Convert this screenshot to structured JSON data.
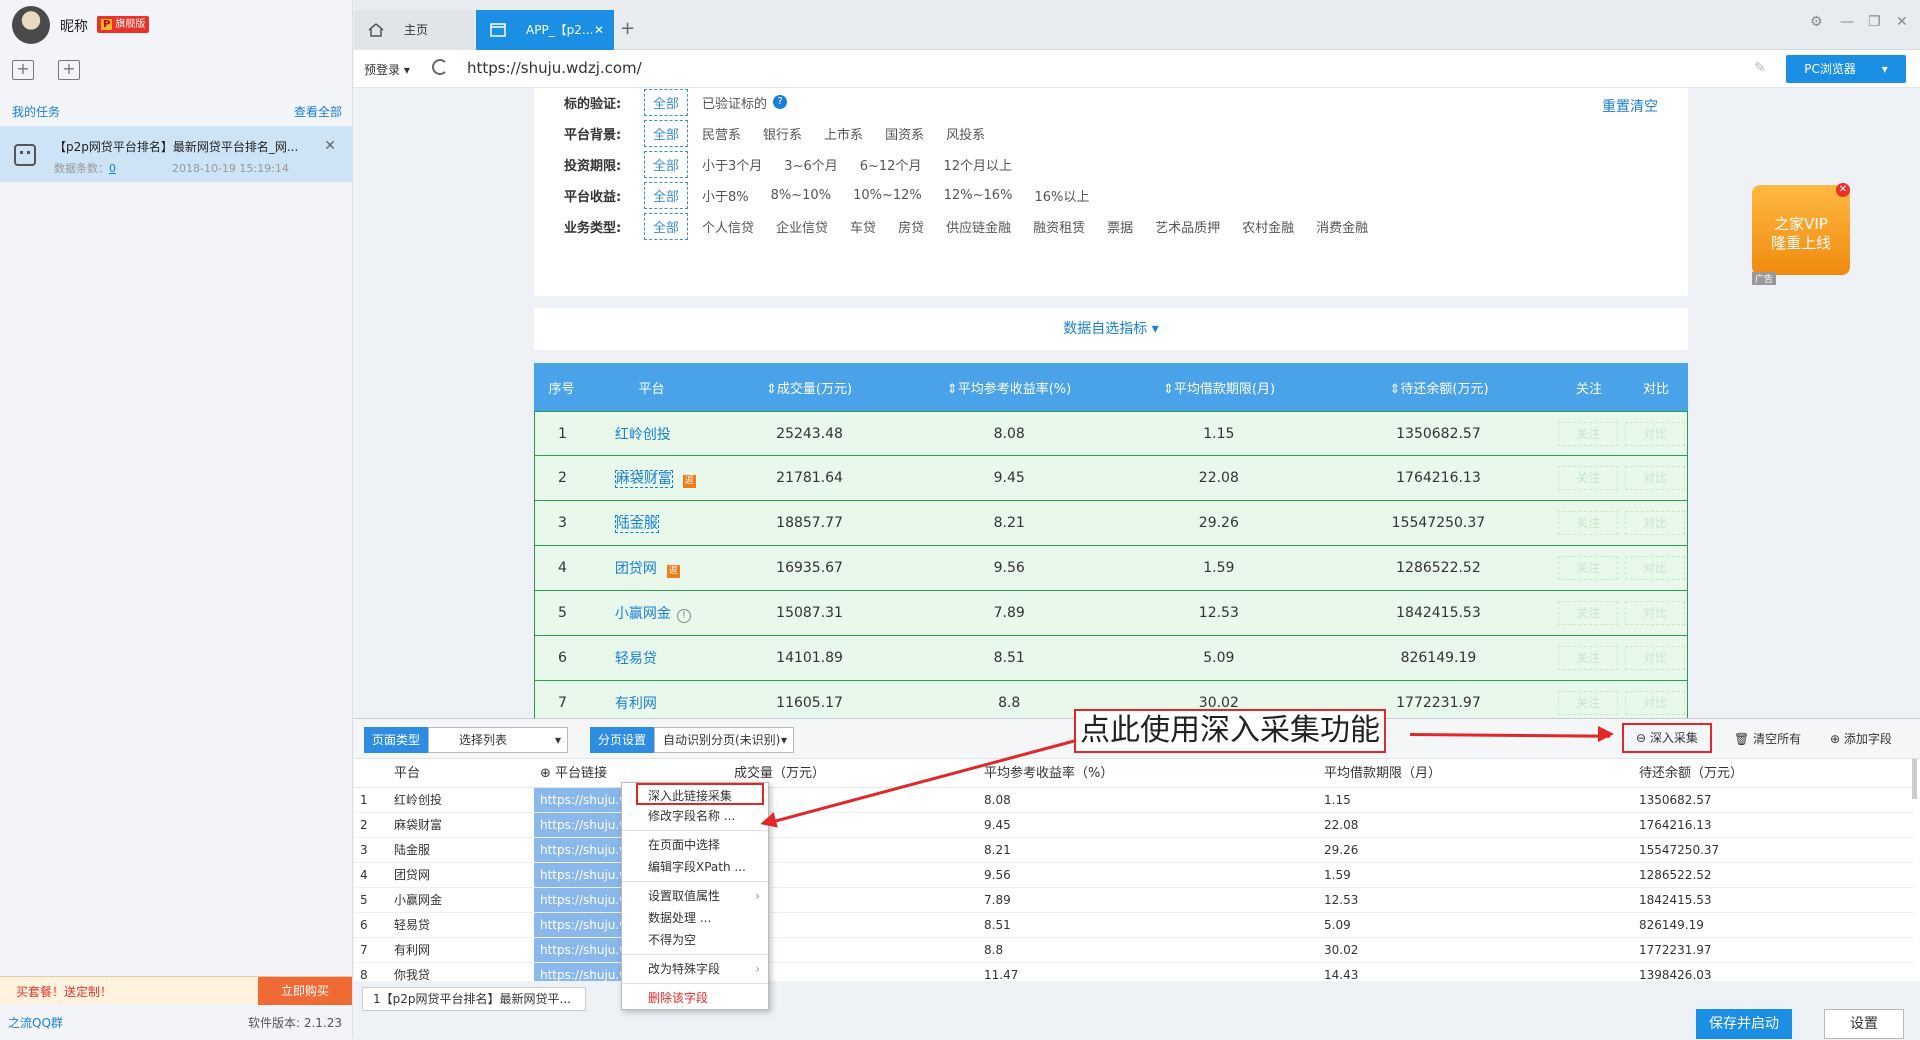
{
  "user": {
    "nickname": "昵称",
    "badge_p": "P",
    "badge_text": "旗舰版"
  },
  "sidebar": {
    "my_tasks": "我的任务",
    "view_all": "查看全部",
    "task": {
      "title": "【p2p网贷平台排名】最新网贷平台排名_网...",
      "count_label": "数据条数：",
      "count": "0",
      "time": "2018-10-19 15:19:14"
    },
    "promo": {
      "text": "买套餐！送定制！",
      "buy": "立即购买"
    },
    "qq": "之流QQ群",
    "version": "软件版本: 2.1.23"
  },
  "tabs": [
    {
      "label": "主页"
    },
    {
      "label": "APP_【p2..."
    }
  ],
  "address": {
    "prelogin": "预登录",
    "url": "https://shuju.wdzj.com/",
    "mode_button": "PC浏览器"
  },
  "filters": {
    "reset": "重置清空",
    "all": "全部",
    "rows": [
      {
        "label": "标的验证:",
        "options": [
          "已验证标的"
        ]
      },
      {
        "label": "平台背景:",
        "options": [
          "民营系",
          "银行系",
          "上市系",
          "国资系",
          "风投系"
        ]
      },
      {
        "label": "投资期限:",
        "options": [
          "小于3个月",
          "3~6个月",
          "6~12个月",
          "12个月以上"
        ]
      },
      {
        "label": "平台收益:",
        "options": [
          "小于8%",
          "8%~10%",
          "10%~12%",
          "12%~16%",
          "16%以上"
        ]
      },
      {
        "label": "业务类型:",
        "options": [
          "个人信贷",
          "企业信贷",
          "车贷",
          "房贷",
          "供应链金融",
          "融资租赁",
          "票据",
          "艺术品质押",
          "农村金融",
          "消费金融"
        ]
      }
    ]
  },
  "custom_indicators": "数据自选指标",
  "table": {
    "headers": [
      "序号",
      "平台",
      "成交量(万元)",
      "平均参考收益率(%)",
      "平均借款期限(月)",
      "待还余额(万元)",
      "关注",
      "对比"
    ],
    "follow": "关注",
    "compare": "对比",
    "rows": [
      {
        "no": "1",
        "name": "红岭创投",
        "vol": "25243.48",
        "rate": "8.08",
        "term": "1.15",
        "bal": "1350682.57"
      },
      {
        "no": "2",
        "name": "麻袋财富",
        "vol": "21781.64",
        "rate": "9.45",
        "term": "22.08",
        "bal": "1764216.13",
        "tag": "返"
      },
      {
        "no": "3",
        "name": "陆金服",
        "vol": "18857.77",
        "rate": "8.21",
        "term": "29.26",
        "bal": "15547250.37"
      },
      {
        "no": "4",
        "name": "团贷网",
        "vol": "16935.67",
        "rate": "9.56",
        "term": "1.59",
        "bal": "1286522.52",
        "tag": "返"
      },
      {
        "no": "5",
        "name": "小赢网金",
        "vol": "15087.31",
        "rate": "7.89",
        "term": "12.53",
        "bal": "1842415.53",
        "warn": "!"
      },
      {
        "no": "6",
        "name": "轻易贷",
        "vol": "14101.89",
        "rate": "8.51",
        "term": "5.09",
        "bal": "826149.19"
      },
      {
        "no": "7",
        "name": "有利网",
        "vol": "11605.17",
        "rate": "8.8",
        "term": "30.02",
        "bal": "1772231.97"
      }
    ]
  },
  "ad": {
    "line1": "之家VIP",
    "line2": "隆重上线",
    "tag": "广告"
  },
  "panel": {
    "page_type_label": "页面类型",
    "page_type_value": "选择列表",
    "paging_label": "分页设置",
    "paging_value": "自动识别分页(未识别)",
    "deep_collect": "深入采集",
    "clear_all": "清空所有",
    "add_field": "添加字段",
    "callout": "点此使用深入采集功能",
    "headers": [
      "平台",
      "平台链接",
      "成交量（万元）",
      "平均参考收益率（%）",
      "平均借款期限（月）",
      "待还余额（万元）"
    ],
    "rows": [
      {
        "no": "1",
        "name": "红岭创投",
        "link": "https://shuju.w",
        "vol": ".48",
        "rate": "8.08",
        "term": "1.15",
        "bal": "1350682.57"
      },
      {
        "no": "2",
        "name": "麻袋财富",
        "link": "https://shuju.w",
        "vol": ".64",
        "rate": "9.45",
        "term": "22.08",
        "bal": "1764216.13"
      },
      {
        "no": "3",
        "name": "陆金服",
        "link": "https://shuju.w",
        "vol": ".77",
        "rate": "8.21",
        "term": "29.26",
        "bal": "15547250.37"
      },
      {
        "no": "4",
        "name": "团贷网",
        "link": "https://shuju.w",
        "vol": ".67",
        "rate": "9.56",
        "term": "1.59",
        "bal": "1286522.52"
      },
      {
        "no": "5",
        "name": "小赢网金",
        "link": "https://shuju.w",
        "vol": ".31",
        "rate": "7.89",
        "term": "12.53",
        "bal": "1842415.53"
      },
      {
        "no": "6",
        "name": "轻易贷",
        "link": "https://shuju.w",
        "vol": ".89",
        "rate": "8.51",
        "term": "5.09",
        "bal": "826149.19"
      },
      {
        "no": "7",
        "name": "有利网",
        "link": "https://shuju.w",
        "vol": ".17",
        "rate": "8.8",
        "term": "30.02",
        "bal": "1772231.97"
      },
      {
        "no": "8",
        "name": "你我贷",
        "link": "https://shuju.w",
        "vol": ".57",
        "rate": "11.47",
        "term": "14.43",
        "bal": "1398426.03"
      }
    ],
    "job_tab": "1【p2p网贷平台排名】最新网贷平...",
    "save_start": "保存并启动",
    "settings": "设置"
  },
  "context_menu": {
    "items": [
      "深入此链接采集",
      "修改字段名称 ...",
      "在页面中选择",
      "编辑字段XPath ...",
      "设置取值属性",
      "数据处理 ...",
      "不得为空",
      "改为特殊字段",
      "删除该字段"
    ]
  }
}
